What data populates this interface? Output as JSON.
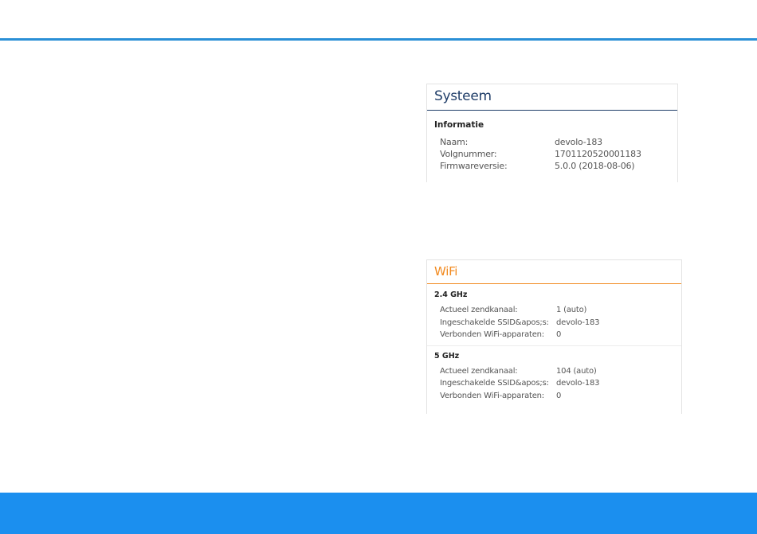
{
  "system": {
    "title": "Systeem",
    "section": "Informatie",
    "rows": [
      {
        "label": "Naam:",
        "value": "devolo-183"
      },
      {
        "label": "Volgnummer:",
        "value": "1701120520001183"
      },
      {
        "label": "Firmwareversie:",
        "value": "5.0.0 (2018-08-06)"
      }
    ]
  },
  "wifi": {
    "title": "WiFi",
    "bands": [
      {
        "name": "2.4 GHz",
        "rows": [
          {
            "label": "Actueel zendkanaal:",
            "value": "1 (auto)"
          },
          {
            "label": "Ingeschakelde SSID&apos;s:",
            "value": "devolo-183"
          },
          {
            "label": "Verbonden WiFi-apparaten:",
            "value": "0"
          }
        ]
      },
      {
        "name": "5 GHz",
        "rows": [
          {
            "label": "Actueel zendkanaal:",
            "value": "104 (auto)"
          },
          {
            "label": "Ingeschakelde SSID&apos;s:",
            "value": "devolo-183"
          },
          {
            "label": "Verbonden WiFi-apparaten:",
            "value": "0"
          }
        ]
      }
    ]
  },
  "colors": {
    "accent_blue": "#2a8fd6",
    "footer_blue": "#1b8fef",
    "system_title": "#1f3d68",
    "wifi_title": "#f28a1f"
  }
}
